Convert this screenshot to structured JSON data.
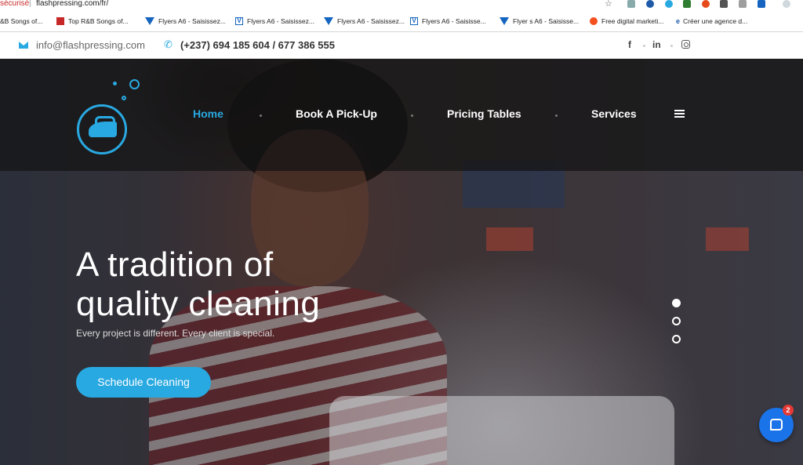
{
  "browser": {
    "insecure_label": "sécurisé",
    "url": "flashpressing.com/fr/",
    "bookmarks": [
      {
        "icon": "none",
        "label": "&B Songs of..."
      },
      {
        "icon": "red-logo",
        "label": "Top R&B Songs of..."
      },
      {
        "icon": "blue-triangle",
        "label": "Flyers A6 - Saisissez..."
      },
      {
        "icon": "v-box",
        "label": "Flyers A6 - Saisissez..."
      },
      {
        "icon": "blue-triangle",
        "label": "Flyers A6 - Saisissez..."
      },
      {
        "icon": "v-box",
        "label": "Flyers  A6 - Saisisse..."
      },
      {
        "icon": "blue-triangle",
        "label": "Flyer s A6 - Saisisse..."
      },
      {
        "icon": "globe",
        "label": "Free digital marketi..."
      },
      {
        "icon": "eo",
        "label": "Créer une agence d..."
      }
    ]
  },
  "topbar": {
    "email": "info@flashpressing.com",
    "phone": "(+237) 694 185 604 / 677 386 555",
    "social": [
      "f",
      "in",
      "instagram"
    ]
  },
  "nav": {
    "items": [
      "Home",
      "Book A Pick-Up",
      "Pricing Tables",
      "Services"
    ],
    "active_index": 0
  },
  "hero": {
    "title_line1": "A tradition of",
    "title_line2": "quality cleaning",
    "subtitle": "Every project is different. Every client is special.",
    "cta_label": "Schedule Cleaning",
    "slides": 3,
    "active_slide": 0
  },
  "chat": {
    "badge_count": "2"
  },
  "colors": {
    "accent": "#29a9e1",
    "chat": "#1a73e8",
    "badge": "#e53935"
  }
}
